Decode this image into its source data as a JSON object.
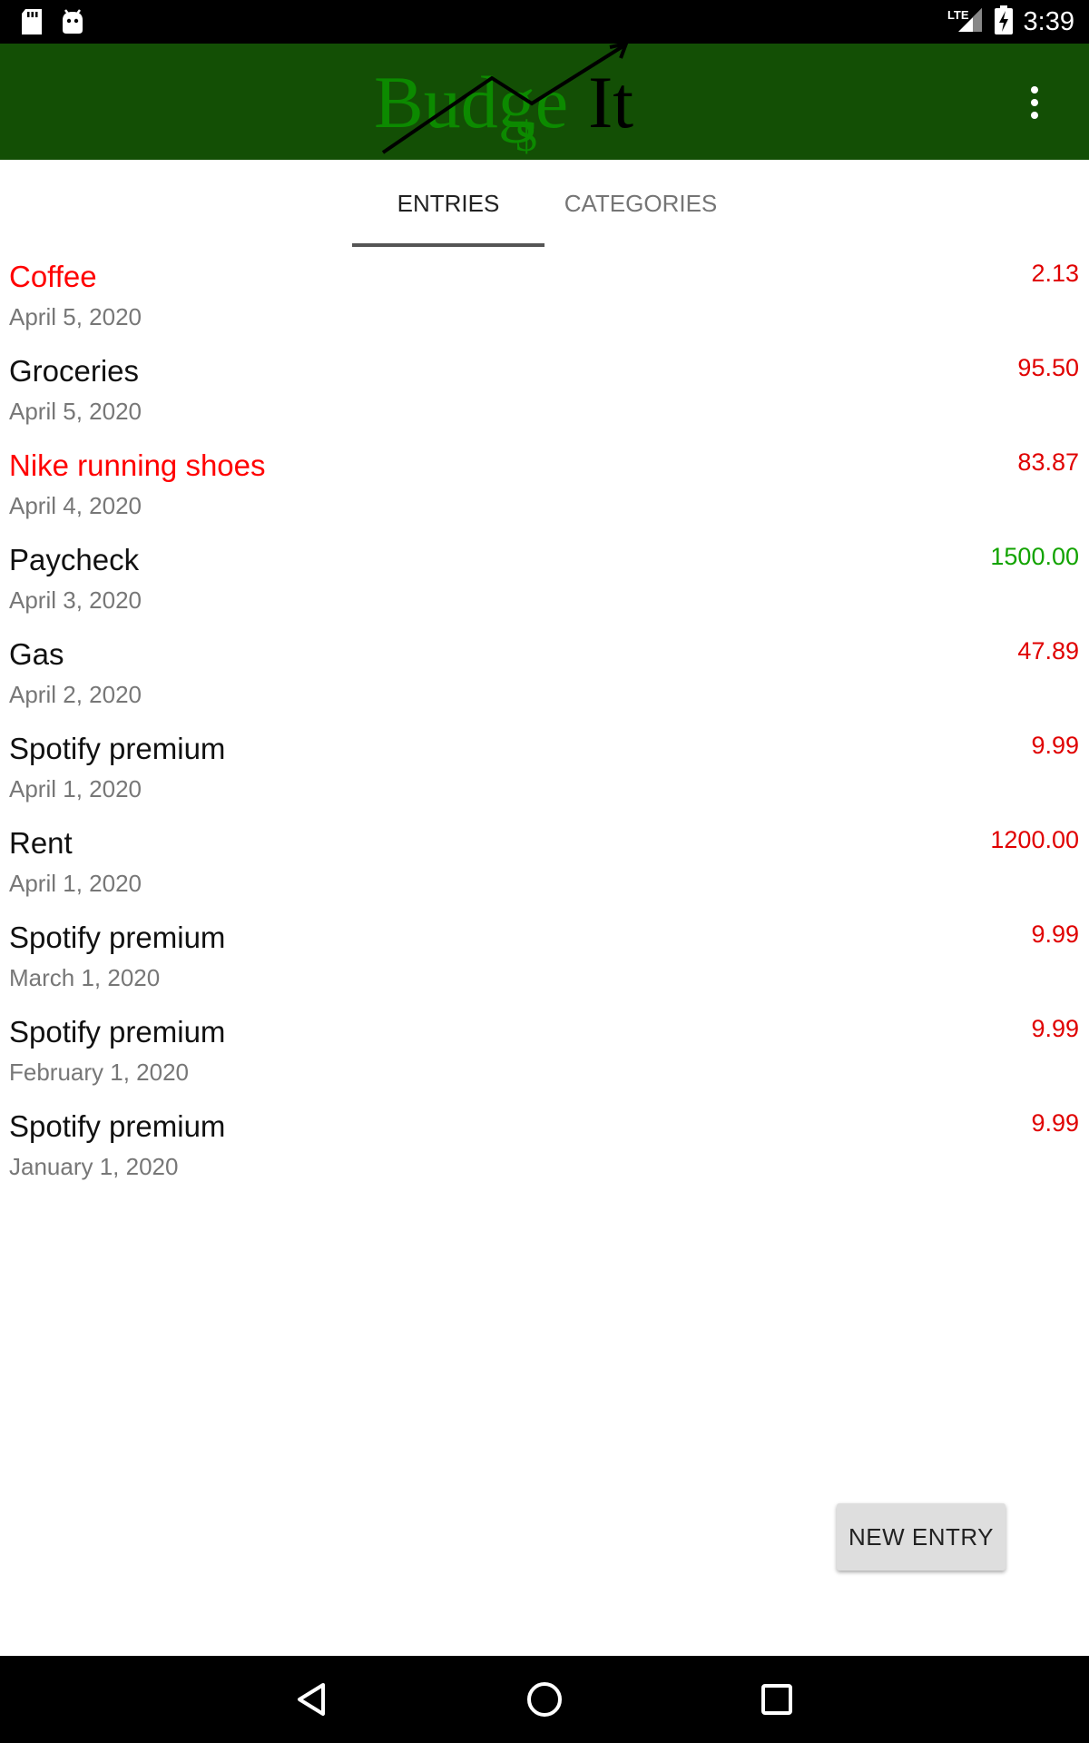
{
  "status_bar": {
    "time": "3:39",
    "network": "LTE",
    "icons": [
      "sd-card-icon",
      "android-icon",
      "signal-icon",
      "battery-charging-icon"
    ]
  },
  "app_bar": {
    "logo_text_budge": "Budge",
    "logo_text_it": "It",
    "logo_dollar": "$",
    "overflow_icon": "more-vert-icon"
  },
  "tabs": [
    {
      "label": "ENTRIES",
      "selected": true
    },
    {
      "label": "CATEGORIES",
      "selected": false
    }
  ],
  "entries": [
    {
      "title": "Coffee",
      "date": "April 5, 2020",
      "amount": "2.13",
      "title_color": "#ff0000",
      "amount_color": "#e00000"
    },
    {
      "title": "Groceries",
      "date": "April 5, 2020",
      "amount": "95.50",
      "title_color": "#111111",
      "amount_color": "#e00000"
    },
    {
      "title": "Nike running shoes",
      "date": "April 4, 2020",
      "amount": "83.87",
      "title_color": "#ff0000",
      "amount_color": "#e00000"
    },
    {
      "title": "Paycheck",
      "date": "April 3, 2020",
      "amount": "1500.00",
      "title_color": "#111111",
      "amount_color": "#12a300"
    },
    {
      "title": "Gas",
      "date": "April 2, 2020",
      "amount": "47.89",
      "title_color": "#111111",
      "amount_color": "#e00000"
    },
    {
      "title": "Spotify premium",
      "date": "April 1, 2020",
      "amount": "9.99",
      "title_color": "#111111",
      "amount_color": "#e00000"
    },
    {
      "title": "Rent",
      "date": "April 1, 2020",
      "amount": "1200.00",
      "title_color": "#111111",
      "amount_color": "#e00000"
    },
    {
      "title": "Spotify premium",
      "date": "March 1, 2020",
      "amount": "9.99",
      "title_color": "#111111",
      "amount_color": "#e00000"
    },
    {
      "title": "Spotify premium",
      "date": "February 1, 2020",
      "amount": "9.99",
      "title_color": "#111111",
      "amount_color": "#e00000"
    },
    {
      "title": "Spotify premium",
      "date": "January 1, 2020",
      "amount": "9.99",
      "title_color": "#111111",
      "amount_color": "#e00000"
    }
  ],
  "new_entry_label": "NEW ENTRY",
  "nav_bar": {
    "icons": [
      "back-icon",
      "home-icon",
      "recents-icon"
    ]
  },
  "colors": {
    "app_bar": "#134f05",
    "expense": "#e00000",
    "income": "#12a300"
  }
}
